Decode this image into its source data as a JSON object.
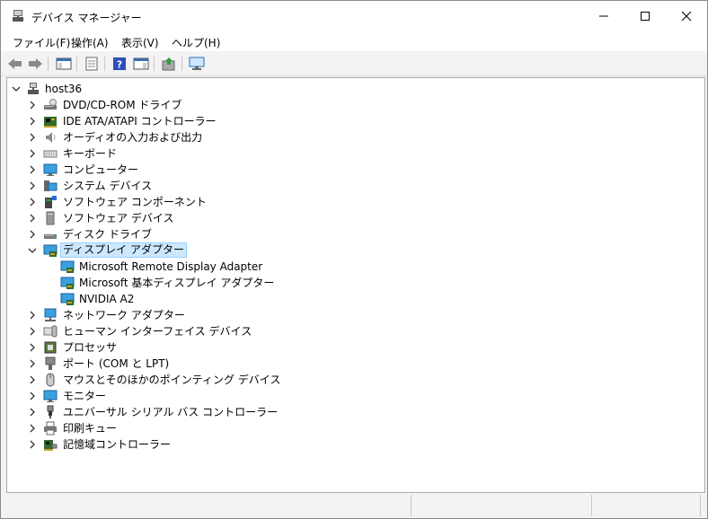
{
  "window": {
    "title": "デバイス マネージャー"
  },
  "menubar": {
    "items": [
      "ファイル(F)",
      "操作(A)",
      "表示(V)",
      "ヘルプ(H)"
    ]
  },
  "tree": {
    "root": "host36",
    "categories": [
      "DVD/CD-ROM ドライブ",
      "IDE ATA/ATAPI コントローラー",
      "オーディオの入力および出力",
      "キーボード",
      "コンピューター",
      "システム デバイス",
      "ソフトウェア コンポーネント",
      "ソフトウェア デバイス",
      "ディスク ドライブ",
      "ディスプレイ アダプター",
      "ネットワーク アダプター",
      "ヒューマン インターフェイス デバイス",
      "プロセッサ",
      "ポート (COM と LPT)",
      "マウスとそのほかのポインティング デバイス",
      "モニター",
      "ユニバーサル シリアル バス コントローラー",
      "印刷キュー",
      "記憶域コントローラー"
    ],
    "display_children": [
      "Microsoft Remote Display Adapter",
      "Microsoft 基本ディスプレイ アダプター",
      "NVIDIA A2"
    ]
  }
}
